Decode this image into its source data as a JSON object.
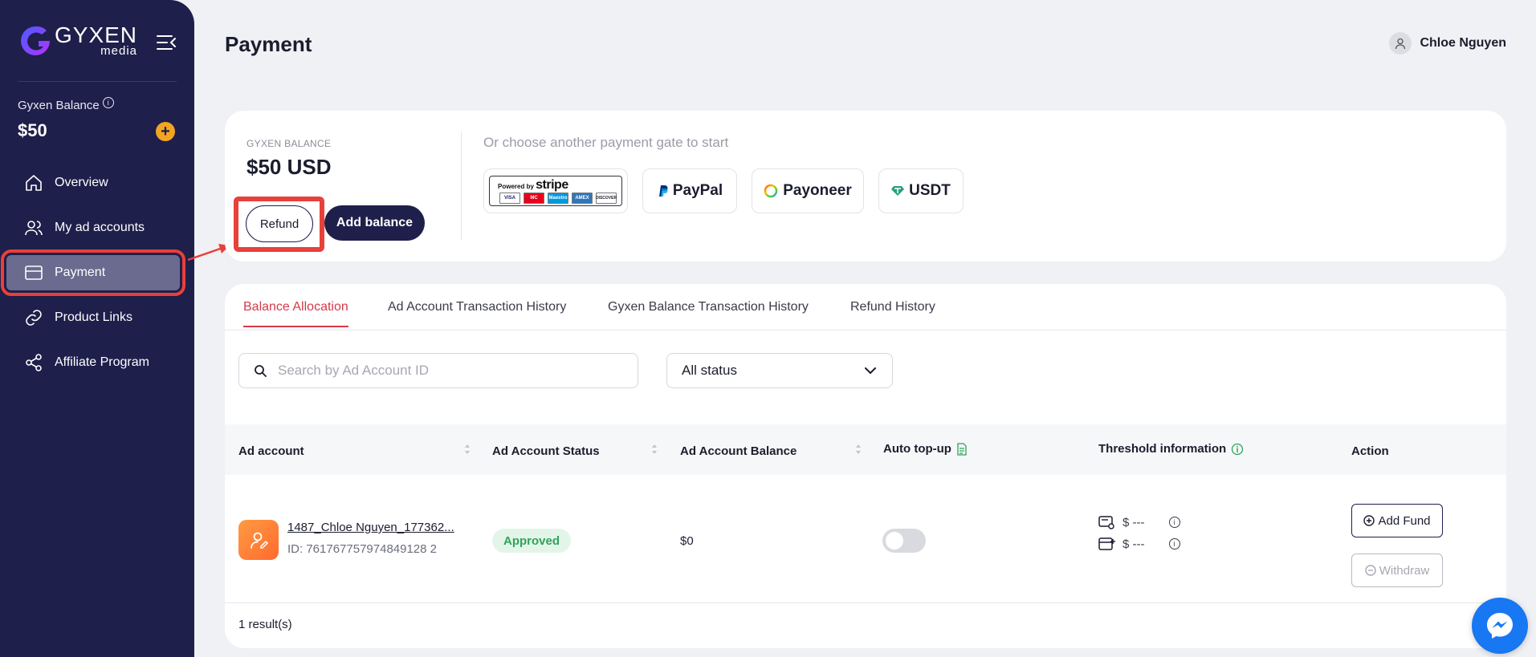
{
  "brand": {
    "name": "GYXEN",
    "sub": "media"
  },
  "sidebar": {
    "balance_label": "Gyxen Balance",
    "balance_value": "$50",
    "items": [
      {
        "label": "Overview",
        "icon": "home-icon"
      },
      {
        "label": "My ad accounts",
        "icon": "users-icon"
      },
      {
        "label": "Payment",
        "icon": "card-icon",
        "active": true
      },
      {
        "label": "Product Links",
        "icon": "link-icon"
      },
      {
        "label": "Affiliate Program",
        "icon": "share-icon"
      }
    ]
  },
  "header": {
    "title": "Payment",
    "user_name": "Chloe Nguyen"
  },
  "balance_card": {
    "label": "GYXEN BALANCE",
    "value": "$50 USD",
    "refund_label": "Refund",
    "add_balance_label": "Add balance",
    "gate_prompt": "Or choose another payment gate to start",
    "gates": [
      {
        "name": "stripe",
        "powered_by": "Powered by",
        "brand": "stripe",
        "cards": [
          "VISA",
          "MC",
          "Maestro",
          "AMEX",
          "DISCOVER"
        ]
      },
      {
        "name": "PayPal"
      },
      {
        "name": "Payoneer"
      },
      {
        "name": "USDT"
      }
    ]
  },
  "tabs": [
    "Balance Allocation",
    "Ad Account Transaction History",
    "Gyxen Balance Transaction History",
    "Refund History"
  ],
  "filters": {
    "search_placeholder": "Search by Ad Account ID",
    "status_value": "All status"
  },
  "table": {
    "columns": [
      "Ad account",
      "Ad Account Status",
      "Ad Account Balance",
      "Auto top-up",
      "Threshold information",
      "Action"
    ],
    "rows": [
      {
        "name": "1487_Chloe Nguyen_177362...",
        "id": "ID: 761767757974849128 2",
        "status": "Approved",
        "balance": "$0",
        "auto_topup": false,
        "threshold_1": "$ ---",
        "threshold_2": "$ ---",
        "add_fund": "Add Fund",
        "withdraw": "Withdraw"
      }
    ],
    "result_count": "1 result(s)"
  },
  "colors": {
    "sidebar": "#1e1f4b",
    "accent": "#d63a4a",
    "highlight": "#e8403a",
    "approved": "#2fa35a",
    "coin": "#f3a521"
  }
}
